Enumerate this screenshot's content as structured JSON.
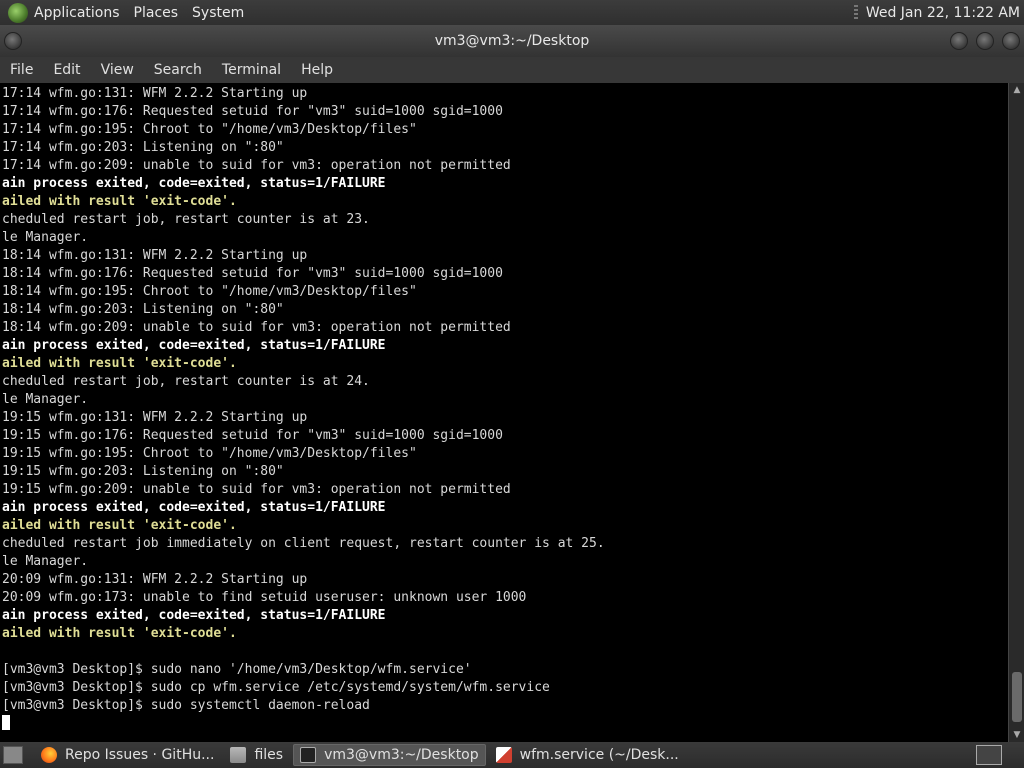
{
  "top_panel": {
    "menus": [
      "Applications",
      "Places",
      "System"
    ],
    "clock": "Wed Jan 22, 11:22 AM"
  },
  "window": {
    "title": "vm3@vm3:~/Desktop"
  },
  "menu_bar": [
    "File",
    "Edit",
    "View",
    "Search",
    "Terminal",
    "Help"
  ],
  "terminal": {
    "lines": [
      {
        "text": "17:14 wfm.go:131: WFM 2.2.2 Starting up",
        "style": "normal"
      },
      {
        "text": "17:14 wfm.go:176: Requested setuid for \"vm3\" suid=1000 sgid=1000",
        "style": "normal"
      },
      {
        "text": "17:14 wfm.go:195: Chroot to \"/home/vm3/Desktop/files\"",
        "style": "normal"
      },
      {
        "text": "17:14 wfm.go:203: Listening on \":80\"",
        "style": "normal"
      },
      {
        "text": "17:14 wfm.go:209: unable to suid for vm3: operation not permitted",
        "style": "normal"
      },
      {
        "text": "ain process exited, code=exited, status=1/FAILURE",
        "style": "bold"
      },
      {
        "text": "ailed with result 'exit-code'.",
        "style": "warn"
      },
      {
        "text": "cheduled restart job, restart counter is at 23.",
        "style": "normal"
      },
      {
        "text": "le Manager.",
        "style": "normal"
      },
      {
        "text": "18:14 wfm.go:131: WFM 2.2.2 Starting up",
        "style": "normal"
      },
      {
        "text": "18:14 wfm.go:176: Requested setuid for \"vm3\" suid=1000 sgid=1000",
        "style": "normal"
      },
      {
        "text": "18:14 wfm.go:195: Chroot to \"/home/vm3/Desktop/files\"",
        "style": "normal"
      },
      {
        "text": "18:14 wfm.go:203: Listening on \":80\"",
        "style": "normal"
      },
      {
        "text": "18:14 wfm.go:209: unable to suid for vm3: operation not permitted",
        "style": "normal"
      },
      {
        "text": "ain process exited, code=exited, status=1/FAILURE",
        "style": "bold"
      },
      {
        "text": "ailed with result 'exit-code'.",
        "style": "warn"
      },
      {
        "text": "cheduled restart job, restart counter is at 24.",
        "style": "normal"
      },
      {
        "text": "le Manager.",
        "style": "normal"
      },
      {
        "text": "19:15 wfm.go:131: WFM 2.2.2 Starting up",
        "style": "normal"
      },
      {
        "text": "19:15 wfm.go:176: Requested setuid for \"vm3\" suid=1000 sgid=1000",
        "style": "normal"
      },
      {
        "text": "19:15 wfm.go:195: Chroot to \"/home/vm3/Desktop/files\"",
        "style": "normal"
      },
      {
        "text": "19:15 wfm.go:203: Listening on \":80\"",
        "style": "normal"
      },
      {
        "text": "19:15 wfm.go:209: unable to suid for vm3: operation not permitted",
        "style": "normal"
      },
      {
        "text": "ain process exited, code=exited, status=1/FAILURE",
        "style": "bold"
      },
      {
        "text": "ailed with result 'exit-code'.",
        "style": "warn"
      },
      {
        "text": "cheduled restart job immediately on client request, restart counter is at 25.",
        "style": "normal"
      },
      {
        "text": "le Manager.",
        "style": "normal"
      },
      {
        "text": "20:09 wfm.go:131: WFM 2.2.2 Starting up",
        "style": "normal"
      },
      {
        "text": "20:09 wfm.go:173: unable to find setuid useruser: unknown user 1000",
        "style": "normal"
      },
      {
        "text": "ain process exited, code=exited, status=1/FAILURE",
        "style": "bold"
      },
      {
        "text": "ailed with result 'exit-code'.",
        "style": "warn"
      },
      {
        "text": "",
        "style": "normal"
      },
      {
        "text": "[vm3@vm3 Desktop]$ sudo nano '/home/vm3/Desktop/wfm.service'",
        "style": "normal"
      },
      {
        "text": "[vm3@vm3 Desktop]$ sudo cp wfm.service /etc/systemd/system/wfm.service",
        "style": "normal"
      },
      {
        "text": "[vm3@vm3 Desktop]$ sudo systemctl daemon-reload",
        "style": "normal"
      }
    ]
  },
  "taskbar": {
    "tasks": [
      {
        "label": "Repo Issues · GitHu...",
        "icon": "firefox-icon",
        "active": false
      },
      {
        "label": "files",
        "icon": "folder-icon",
        "active": false
      },
      {
        "label": "vm3@vm3:~/Desktop",
        "icon": "terminal-icon",
        "active": true
      },
      {
        "label": "wfm.service (~/Desk...",
        "icon": "text-editor-icon",
        "active": false
      }
    ]
  }
}
